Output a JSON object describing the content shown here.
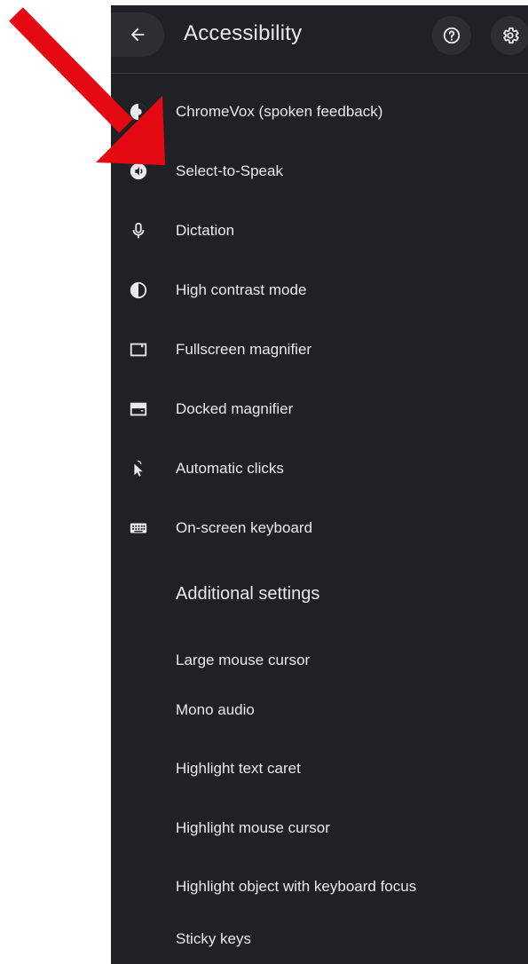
{
  "header": {
    "title": "Accessibility"
  },
  "features": [
    {
      "label": "ChromeVox (spoken feedback)",
      "icon": "chromevox-icon"
    },
    {
      "label": "Select-to-Speak",
      "icon": "select-to-speak-icon"
    },
    {
      "label": "Dictation",
      "icon": "microphone-icon"
    },
    {
      "label": "High contrast mode",
      "icon": "contrast-icon"
    },
    {
      "label": "Fullscreen magnifier",
      "icon": "fullscreen-magnifier-icon"
    },
    {
      "label": "Docked magnifier",
      "icon": "docked-magnifier-icon"
    },
    {
      "label": "Automatic clicks",
      "icon": "automatic-clicks-icon"
    },
    {
      "label": "On-screen keyboard",
      "icon": "keyboard-icon"
    }
  ],
  "additional": {
    "title": "Additional settings",
    "items": [
      {
        "label": "Large mouse cursor"
      },
      {
        "label": "Mono audio"
      },
      {
        "label": "Highlight text caret"
      },
      {
        "label": "Highlight mouse cursor"
      },
      {
        "label": "Highlight object with keyboard focus"
      },
      {
        "label": "Sticky keys"
      }
    ]
  },
  "colors": {
    "panel_bg": "#202124",
    "text": "#e8eaed",
    "annotation_arrow": "#e50914"
  }
}
